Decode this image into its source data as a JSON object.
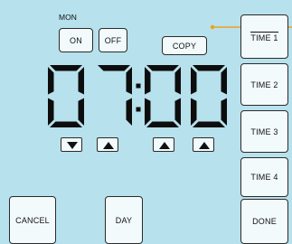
{
  "display": {
    "day": "MON",
    "time": "07:00"
  },
  "buttons": {
    "on": "ON",
    "off": "OFF",
    "copy": "COPY",
    "time1": "TIME 1",
    "time2": "TIME 2",
    "time3": "TIME 3",
    "time4": "TIME 4",
    "cancel": "CANCEL",
    "day": "DAY",
    "done": "DONE"
  },
  "colors": {
    "screen": "#b7e1ec",
    "ink": "#111111",
    "callout": "#f0a020"
  },
  "icons": {
    "hour_down": "triangle-down-icon",
    "hour_up": "triangle-up-icon",
    "minute_up_1": "triangle-up-icon",
    "minute_up_2": "triangle-up-icon"
  }
}
